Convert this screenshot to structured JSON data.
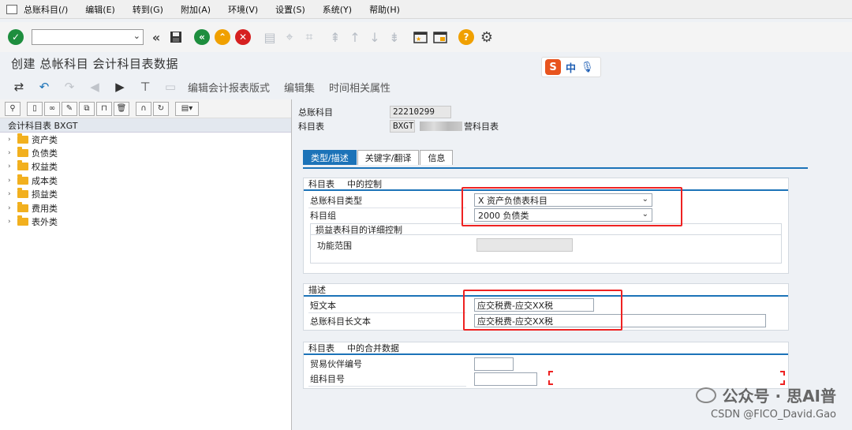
{
  "menu": [
    "总账科目(/)",
    "编辑(E)",
    "转到(G)",
    "附加(A)",
    "环境(V)",
    "设置(S)",
    "系统(Y)",
    "帮助(H)"
  ],
  "command_field": "",
  "title": "创建 总帐科目 会计科目表数据",
  "ime": {
    "logo": "S",
    "lang": "中"
  },
  "app_toolbar": {
    "edit_fs": "编辑会计报表版式",
    "edit_set": "编辑集",
    "time_attr": "时间相关属性"
  },
  "tree": {
    "header": "会计科目表 BXGT",
    "items": [
      "资产类",
      "负债类",
      "权益类",
      "成本类",
      "损益类",
      "费用类",
      "表外类"
    ]
  },
  "header": {
    "gl_label": "总账科目",
    "gl_value": "22210299",
    "coa_label": "科目表",
    "coa_value": "BXGT",
    "coa_desc": "营科目表"
  },
  "tabs": [
    "类型/描述",
    "关键字/翻译",
    "信息"
  ],
  "control": {
    "title_a": "科目表",
    "title_b": "中的控制",
    "type_label": "总账科目类型",
    "type_value": "X 资产负债表科目",
    "group_label": "科目组",
    "group_value": "2000 负债类",
    "sub_title": "损益表科目的详细控制",
    "func_label": "功能范围",
    "func_value": ""
  },
  "description": {
    "title": "描述",
    "short_label": "短文本",
    "short_value": "应交税费-应交XX税",
    "long_label": "总账科目长文本",
    "long_value": "应交税费-应交XX税"
  },
  "consolidation": {
    "title_a": "科目表",
    "title_b": "中的合并数据",
    "partner_label": "贸易伙伴编号",
    "partner_value": "",
    "group_acct_label": "组科目号",
    "group_acct_value": ""
  },
  "watermark": {
    "line1": "公众号 · 思AI普",
    "line2": "CSDN @FICO_David.Gao"
  },
  "colors": {
    "accent": "#1c73b8",
    "highlight": "#e22222",
    "folder": "#f2b01e"
  }
}
